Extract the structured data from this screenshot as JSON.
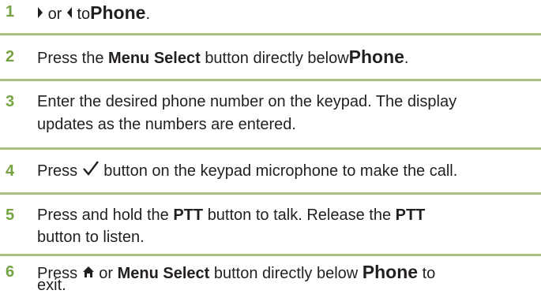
{
  "steps": [
    {
      "num": "1",
      "or": "or",
      "to": "to",
      "target": "Phone",
      "end": "."
    },
    {
      "num": "2",
      "pre": "Press the",
      "bold": "Menu Select",
      "mid": "button directly below",
      "target": "Phone",
      "end": "."
    },
    {
      "num": "3",
      "line1": "Enter the desired phone number on the keypad. The display",
      "line2": "updates as the numbers are entered."
    },
    {
      "num": "4",
      "pre": "Press",
      "post": "button on the keypad microphone to make the call."
    },
    {
      "num": "5",
      "l1_pre": "Press and hold the",
      "bold1": "PTT",
      "l1_mid": "button to talk. Release the",
      "bold2": "PTT",
      "line2": "button to listen."
    },
    {
      "num": "6",
      "pre": "Press",
      "or": "or",
      "bold": "Menu Select",
      "mid": "button directly below",
      "target": "Phone",
      "post": "to",
      "line2": "exit."
    }
  ],
  "icons": {
    "right": "right-arrow-icon",
    "left": "left-arrow-icon",
    "check": "checkmark-icon",
    "home": "home-icon"
  },
  "colors": {
    "step_number": "#76a342",
    "rule": "#a9c183",
    "text": "#231f20"
  }
}
